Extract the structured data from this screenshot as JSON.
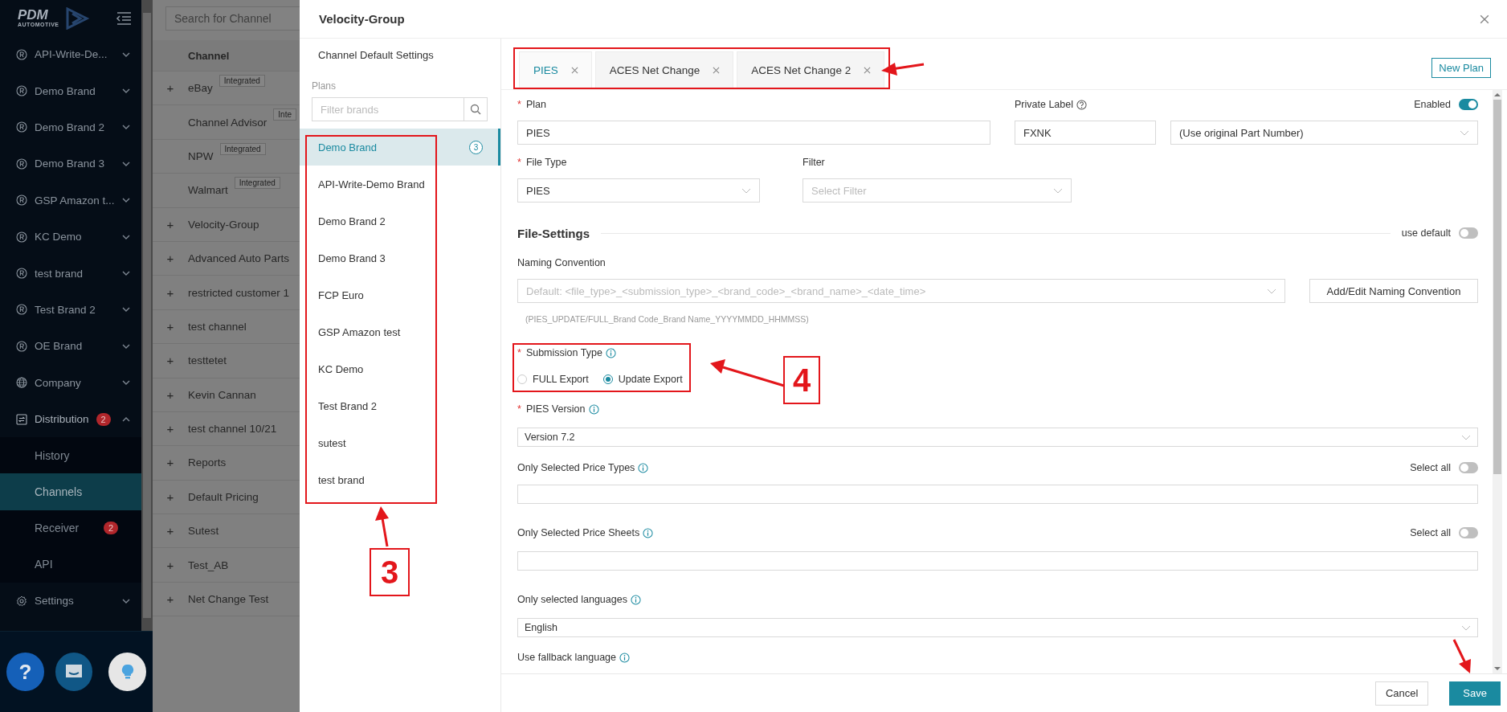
{
  "sidebar": {
    "logo": "PDM",
    "logo_sub": "AUTOMOTIVE",
    "items": [
      {
        "kind": "brand",
        "label": "API-Write-De...",
        "expanded": false
      },
      {
        "kind": "brand",
        "label": "Demo Brand",
        "expanded": false
      },
      {
        "kind": "brand",
        "label": "Demo Brand 2",
        "expanded": false
      },
      {
        "kind": "brand",
        "label": "Demo Brand 3",
        "expanded": false
      },
      {
        "kind": "brand",
        "label": "GSP Amazon t...",
        "expanded": false
      },
      {
        "kind": "brand",
        "label": "KC Demo",
        "expanded": false
      },
      {
        "kind": "brand",
        "label": "test brand",
        "expanded": false
      },
      {
        "kind": "brand",
        "label": "Test Brand 2",
        "expanded": false
      },
      {
        "kind": "brand",
        "label": "OE Brand",
        "expanded": false
      },
      {
        "kind": "company",
        "label": "Company",
        "expanded": false
      },
      {
        "kind": "distribution",
        "label": "Distribution",
        "badge": "2",
        "expanded": true,
        "children": [
          {
            "label": "History",
            "selected": false
          },
          {
            "label": "Channels",
            "selected": true
          },
          {
            "label": "Receiver",
            "badge": "2",
            "selected": false
          },
          {
            "label": "API",
            "selected": false
          }
        ]
      },
      {
        "kind": "settings",
        "label": "Settings",
        "expanded": false
      }
    ],
    "support_buttons": [
      {
        "kind": "help",
        "label": "?"
      },
      {
        "kind": "chat"
      },
      {
        "kind": "tips"
      }
    ]
  },
  "channel_panel": {
    "search": {
      "placeholder": "Search for Channel"
    },
    "column": "Channel",
    "rows": [
      {
        "expander": "+",
        "name": "eBay",
        "badge": "Integrated"
      },
      {
        "name": "Channel Advisor",
        "badge": "Inte"
      },
      {
        "name": "NPW",
        "badge": "Integrated"
      },
      {
        "name": "Walmart",
        "badge": "Integrated"
      },
      {
        "expander": "+",
        "name": "Velocity-Group"
      },
      {
        "expander": "+",
        "name": "Advanced Auto Parts"
      },
      {
        "expander": "+",
        "name": "restricted customer 1"
      },
      {
        "expander": "+",
        "name": "test channel"
      },
      {
        "expander": "+",
        "name": "testtetet"
      },
      {
        "expander": "+",
        "name": "Kevin Cannan"
      },
      {
        "expander": "+",
        "name": "test channel 10/21"
      },
      {
        "expander": "+",
        "name": "Reports"
      },
      {
        "expander": "+",
        "name": "Default Pricing"
      },
      {
        "expander": "+",
        "name": "Sutest"
      },
      {
        "expander": "+",
        "name": "Test_AB"
      },
      {
        "expander": "+",
        "name": "Net Change Test"
      }
    ]
  },
  "modal": {
    "title": "Velocity-Group",
    "plans_panel": {
      "default_settings": "Channel Default Settings",
      "heading": "Plans",
      "filter": {
        "placeholder": "Filter brands"
      },
      "highlighted": true,
      "callout": "3",
      "brands": [
        {
          "name": "Demo Brand",
          "count": "3",
          "selected": true
        },
        {
          "name": "API-Write-Demo Brand",
          "selected": false
        },
        {
          "name": "Demo Brand 2",
          "selected": false
        },
        {
          "name": "Demo Brand 3",
          "selected": false
        },
        {
          "name": "FCP Euro",
          "selected": false
        },
        {
          "name": "GSP Amazon test",
          "selected": false
        },
        {
          "name": "KC Demo",
          "selected": false
        },
        {
          "name": "Test Brand 2",
          "selected": false
        },
        {
          "name": "sutest",
          "selected": false
        },
        {
          "name": "test brand",
          "selected": false
        }
      ]
    },
    "tabs": {
      "highlighted": true,
      "items": [
        {
          "label": "PIES",
          "selected": true
        },
        {
          "label": "ACES Net Change",
          "selected": false
        },
        {
          "label": "ACES Net Change 2",
          "selected": false
        }
      ]
    },
    "new_plan": "New Plan",
    "form": {
      "plan": {
        "required_mark": "*",
        "label": "Plan",
        "value": "PIES"
      },
      "private_label": {
        "label": "Private Label",
        "value": "FXNK",
        "option": "(Use original Part Number)"
      },
      "enabled": {
        "label": "Enabled",
        "on": true
      },
      "file_type": {
        "required_mark": "*",
        "label": "File Type",
        "value": "PIES"
      },
      "filter": {
        "label": "Filter",
        "placeholder": "Select Filter"
      },
      "file_settings": {
        "heading": "File-Settings",
        "use_default": {
          "label": "use default",
          "on": false
        }
      },
      "naming_convention": {
        "label": "Naming Convention",
        "placeholder": "Default: <file_type>_<submission_type>_<brand_code>_<brand_name>_<date_time>",
        "button": "Add/Edit Naming Convention",
        "hint": "(PIES_UPDATE/FULL_Brand Code_Brand Name_YYYYMMDD_HHMMSS)"
      },
      "submission_type": {
        "required_mark": "*",
        "label": "Submission Type",
        "highlighted": true,
        "callout": "4",
        "options": [
          {
            "label": "FULL Export",
            "selected": false
          },
          {
            "label": "Update Export",
            "selected": true
          }
        ]
      },
      "pies_version": {
        "required_mark": "*",
        "label": "PIES Version",
        "value": "Version 7.2"
      },
      "price_types": {
        "label": "Only Selected Price Types",
        "select_all": {
          "label": "Select all",
          "on": false
        }
      },
      "price_sheets": {
        "label": "Only Selected Price Sheets",
        "select_all": {
          "label": "Select all",
          "on": false
        }
      },
      "languages": {
        "label": "Only selected languages",
        "value": "English"
      },
      "fallback_language": {
        "label": "Use fallback language"
      }
    },
    "footer": {
      "cancel": "Cancel",
      "save": "Save",
      "pointed": true
    }
  }
}
